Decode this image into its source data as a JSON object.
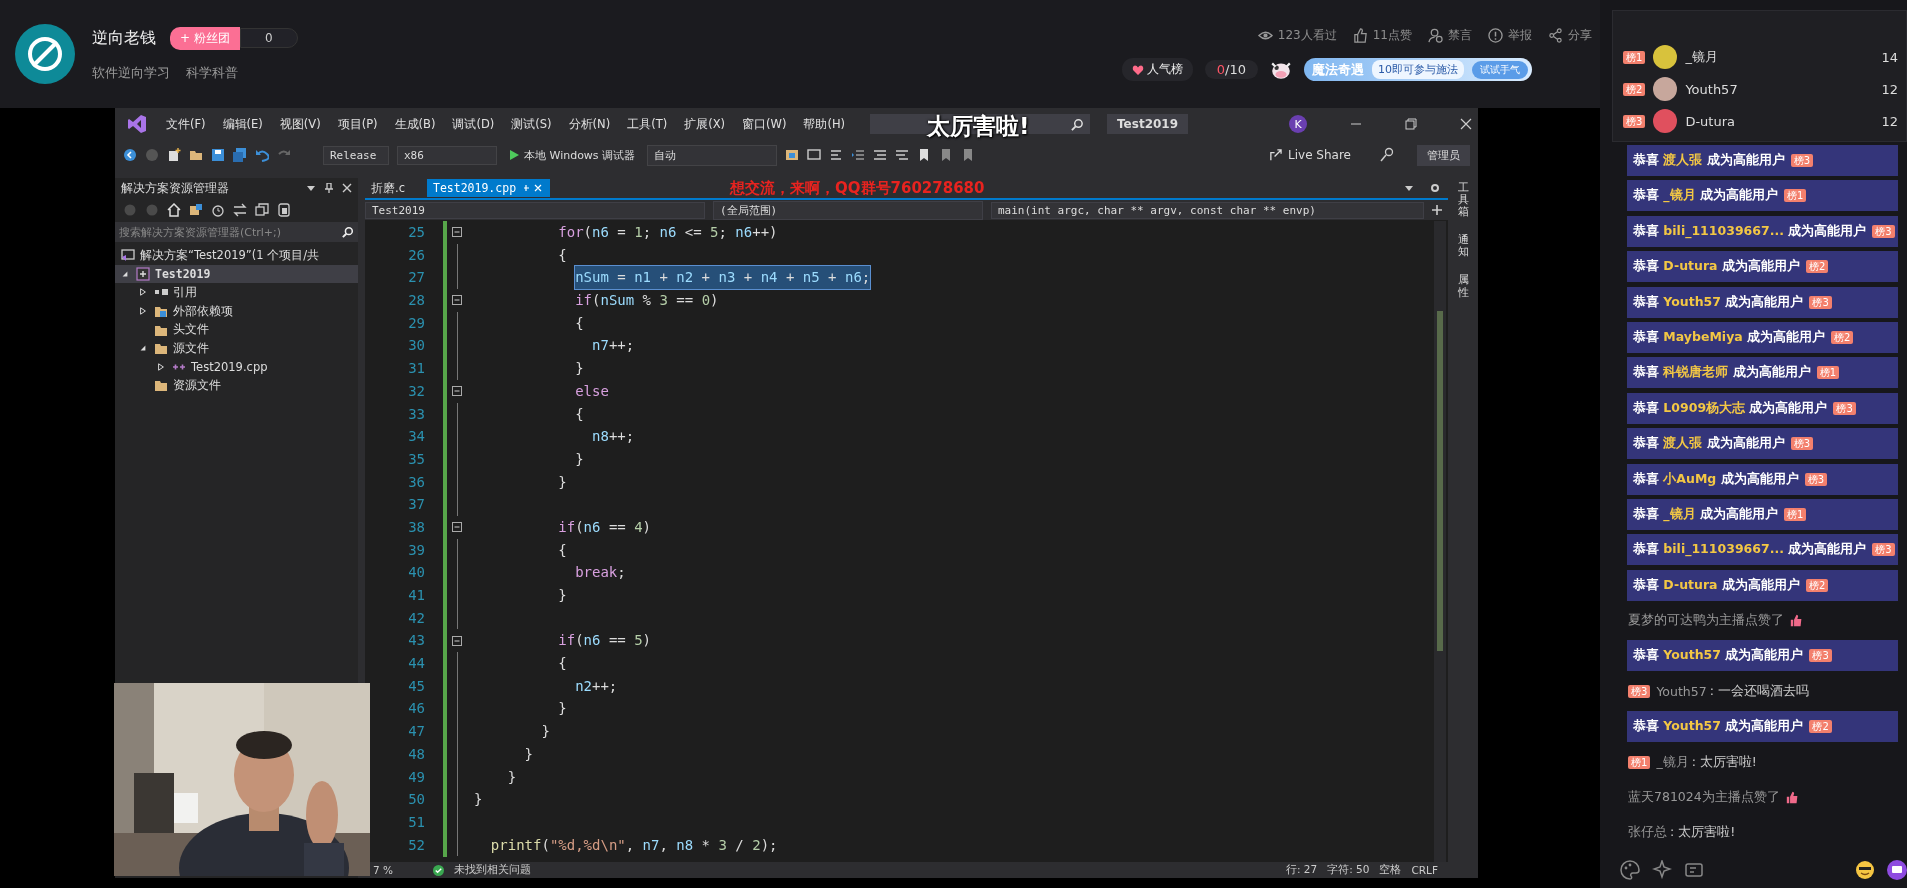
{
  "header": {
    "streamer": "逆向老钱",
    "fan_club": {
      "label": "+ 粉丝团",
      "count": "0"
    },
    "tags": [
      "软件逆向学习",
      "科学科普"
    ],
    "stats": [
      {
        "kind": "views",
        "label": "123人看过"
      },
      {
        "kind": "likes",
        "label": "11点赞"
      },
      {
        "kind": "mute",
        "label": "禁言"
      },
      {
        "kind": "report",
        "label": "举报"
      },
      {
        "kind": "share",
        "label": "分享"
      }
    ],
    "popularity": "人气榜",
    "progress_value": "0",
    "progress_total": "/10",
    "magic": {
      "title": "魔法奇遇",
      "text": "10即可参与施法",
      "button": "试试手气"
    }
  },
  "danmaku": "太厉害啦!",
  "overlay_text": "想交流，来啊，QQ群号760278680",
  "ide": {
    "menu": [
      "文件(F)",
      "编辑(E)",
      "视图(V)",
      "项目(P)",
      "生成(B)",
      "调试(D)",
      "测试(S)",
      "分析(N)",
      "工具(T)",
      "扩展(X)",
      "窗口(W)",
      "帮助(H)"
    ],
    "title": "Test2019",
    "account": "K",
    "toolbar": {
      "config": "Release",
      "platform": "x86",
      "debugger": "本地 Windows 调试器",
      "mode": "自动",
      "live_share": "Live Share",
      "admin": "管理员"
    },
    "explorer": {
      "title": "解决方案资源管理器",
      "search_placeholder": "搜索解决方案资源管理器(Ctrl+;)",
      "tree": [
        {
          "kind": "solution",
          "label": "解决方案“Test2019”(1 个项目/共",
          "selected": false,
          "children": [
            {
              "kind": "project",
              "label": "Test2019",
              "expanded": true,
              "selected": true,
              "children": [
                {
                  "kind": "references",
                  "label": "引用",
                  "expanded": false,
                  "selected": false
                },
                {
                  "kind": "external",
                  "label": "外部依赖项",
                  "expanded": false,
                  "selected": false
                },
                {
                  "kind": "filter",
                  "label": "头文件",
                  "selected": false
                },
                {
                  "kind": "filter",
                  "label": "源文件",
                  "expanded": true,
                  "selected": false,
                  "children": [
                    {
                      "kind": "cpp",
                      "label": "Test2019.cpp",
                      "expanded": false,
                      "selected": false
                    }
                  ]
                },
                {
                  "kind": "filter",
                  "label": "资源文件",
                  "selected": false
                }
              ]
            }
          ]
        }
      ]
    },
    "tabs": [
      {
        "label": "折磨.c",
        "selected": false
      },
      {
        "label": "Test2019.cpp",
        "selected": true
      }
    ],
    "nav": [
      "Test2019",
      "(全局范围)",
      "main(int argc, char ** argv, const char ** envp)"
    ],
    "code": [
      {
        "n": "25",
        "collapsible": true,
        "selected": false,
        "tokens": [
          {
            "text": "          for",
            "kind": "keyword"
          },
          {
            "text": "(",
            "kind": "punct"
          },
          {
            "text": "n6",
            "kind": "variable"
          },
          {
            "text": " = ",
            "kind": "punct"
          },
          {
            "text": "1",
            "kind": "number"
          },
          {
            "text": "; ",
            "kind": "punct"
          },
          {
            "text": "n6",
            "kind": "variable"
          },
          {
            "text": " <= ",
            "kind": "punct"
          },
          {
            "text": "5",
            "kind": "number"
          },
          {
            "text": "; ",
            "kind": "punct"
          },
          {
            "text": "n6",
            "kind": "variable"
          },
          {
            "text": "++)",
            "kind": "punct"
          }
        ]
      },
      {
        "n": "26",
        "collapsible": false,
        "selected": false,
        "tokens": [
          {
            "text": "          {",
            "kind": "punct"
          }
        ]
      },
      {
        "n": "27",
        "collapsible": false,
        "selected": true,
        "tokens": [
          {
            "text": "            nSum",
            "kind": "variable"
          },
          {
            "text": " = ",
            "kind": "punct"
          },
          {
            "text": "n1",
            "kind": "variable"
          },
          {
            "text": " + ",
            "kind": "punct"
          },
          {
            "text": "n2",
            "kind": "variable"
          },
          {
            "text": " + ",
            "kind": "punct"
          },
          {
            "text": "n3",
            "kind": "variable"
          },
          {
            "text": " + ",
            "kind": "punct"
          },
          {
            "text": "n4",
            "kind": "variable"
          },
          {
            "text": " + ",
            "kind": "punct"
          },
          {
            "text": "n5",
            "kind": "variable"
          },
          {
            "text": " + ",
            "kind": "punct"
          },
          {
            "text": "n6",
            "kind": "variable"
          },
          {
            "text": ";",
            "kind": "punct"
          }
        ]
      },
      {
        "n": "28",
        "collapsible": true,
        "selected": false,
        "tokens": [
          {
            "text": "            if",
            "kind": "keyword"
          },
          {
            "text": "(",
            "kind": "punct"
          },
          {
            "text": "nSum",
            "kind": "variable"
          },
          {
            "text": " % ",
            "kind": "punct"
          },
          {
            "text": "3",
            "kind": "number"
          },
          {
            "text": " == ",
            "kind": "punct"
          },
          {
            "text": "0",
            "kind": "number"
          },
          {
            "text": ")",
            "kind": "punct"
          }
        ]
      },
      {
        "n": "29",
        "collapsible": false,
        "selected": false,
        "tokens": [
          {
            "text": "            {",
            "kind": "punct"
          }
        ]
      },
      {
        "n": "30",
        "collapsible": false,
        "selected": false,
        "tokens": [
          {
            "text": "              n7",
            "kind": "variable"
          },
          {
            "text": "++;",
            "kind": "punct"
          }
        ]
      },
      {
        "n": "31",
        "collapsible": false,
        "selected": false,
        "tokens": [
          {
            "text": "            }",
            "kind": "punct"
          }
        ]
      },
      {
        "n": "32",
        "collapsible": true,
        "selected": false,
        "tokens": [
          {
            "text": "            else",
            "kind": "keyword"
          }
        ]
      },
      {
        "n": "33",
        "collapsible": false,
        "selected": false,
        "tokens": [
          {
            "text": "            {",
            "kind": "punct"
          }
        ]
      },
      {
        "n": "34",
        "collapsible": false,
        "selected": false,
        "tokens": [
          {
            "text": "              n8",
            "kind": "variable"
          },
          {
            "text": "++;",
            "kind": "punct"
          }
        ]
      },
      {
        "n": "35",
        "collapsible": false,
        "selected": false,
        "tokens": [
          {
            "text": "            }",
            "kind": "punct"
          }
        ]
      },
      {
        "n": "36",
        "collapsible": false,
        "selected": false,
        "tokens": [
          {
            "text": "          }",
            "kind": "punct"
          }
        ]
      },
      {
        "n": "37",
        "collapsible": false
      },
      {
        "n": "38",
        "collapsible": true,
        "selected": false,
        "tokens": [
          {
            "text": "          if",
            "kind": "keyword"
          },
          {
            "text": "(",
            "kind": "punct"
          },
          {
            "text": "n6",
            "kind": "variable"
          },
          {
            "text": " == ",
            "kind": "punct"
          },
          {
            "text": "4",
            "kind": "number"
          },
          {
            "text": ")",
            "kind": "punct"
          }
        ]
      },
      {
        "n": "39",
        "collapsible": false,
        "selected": false,
        "tokens": [
          {
            "text": "          {",
            "kind": "punct"
          }
        ]
      },
      {
        "n": "40",
        "collapsible": false,
        "selected": false,
        "tokens": [
          {
            "text": "            break",
            "kind": "keyword"
          },
          {
            "text": ";",
            "kind": "punct"
          }
        ]
      },
      {
        "n": "41",
        "collapsible": false,
        "selected": false,
        "tokens": [
          {
            "text": "          }",
            "kind": "punct"
          }
        ]
      },
      {
        "n": "42",
        "collapsible": false
      },
      {
        "n": "43",
        "collapsible": true,
        "selected": false,
        "tokens": [
          {
            "text": "          if",
            "kind": "keyword"
          },
          {
            "text": "(",
            "kind": "punct"
          },
          {
            "text": "n6",
            "kind": "variable"
          },
          {
            "text": " == ",
            "kind": "punct"
          },
          {
            "text": "5",
            "kind": "number"
          },
          {
            "text": ")",
            "kind": "punct"
          }
        ]
      },
      {
        "n": "44",
        "collapsible": false,
        "selected": false,
        "tokens": [
          {
            "text": "          {",
            "kind": "punct"
          }
        ]
      },
      {
        "n": "45",
        "collapsible": false,
        "selected": false,
        "tokens": [
          {
            "text": "            n2",
            "kind": "variable"
          },
          {
            "text": "++;",
            "kind": "punct"
          }
        ]
      },
      {
        "n": "46",
        "collapsible": false,
        "selected": false,
        "tokens": [
          {
            "text": "          }",
            "kind": "punct"
          }
        ]
      },
      {
        "n": "47",
        "collapsible": false,
        "selected": false,
        "tokens": [
          {
            "text": "        }",
            "kind": "punct"
          }
        ]
      },
      {
        "n": "48",
        "collapsible": false,
        "selected": false,
        "tokens": [
          {
            "text": "      }",
            "kind": "punct"
          }
        ]
      },
      {
        "n": "49",
        "collapsible": false,
        "selected": false,
        "tokens": [
          {
            "text": "    }",
            "kind": "punct"
          }
        ]
      },
      {
        "n": "50",
        "collapsible": false,
        "selected": false,
        "tokens": [
          {
            "text": "}",
            "kind": "punct"
          }
        ]
      },
      {
        "n": "51",
        "collapsible": false
      },
      {
        "n": "52",
        "collapsible": false,
        "selected": false,
        "tokens": [
          {
            "text": "  printf",
            "kind": "function"
          },
          {
            "text": "(",
            "kind": "punct"
          },
          {
            "text": "\"%d,%d\\n\"",
            "kind": "string"
          },
          {
            "text": ", ",
            "kind": "punct"
          },
          {
            "text": "n7",
            "kind": "variable"
          },
          {
            "text": ", ",
            "kind": "punct"
          },
          {
            "text": "n8",
            "kind": "variable"
          },
          {
            "text": " * ",
            "kind": "punct"
          },
          {
            "text": "3",
            "kind": "number"
          },
          {
            "text": " / ",
            "kind": "punct"
          },
          {
            "text": "2",
            "kind": "number"
          },
          {
            "text": ");",
            "kind": "punct"
          }
        ]
      }
    ],
    "status": {
      "zoom": "7 %",
      "issues": "未找到相关问题",
      "line": "行: 27",
      "char": "字符: 50",
      "indent": "空格",
      "eol": "CRLF"
    },
    "side_tabs": [
      "工具箱",
      "通知",
      "属性"
    ]
  },
  "chat": {
    "ranking": [
      {
        "badge": "榜1",
        "name": "_镜月",
        "score": "14",
        "color": "#d8c23c"
      },
      {
        "badge": "榜2",
        "name": "Youth57",
        "score": "12",
        "color": "#c7a79c"
      },
      {
        "badge": "榜3",
        "name": "D-utura",
        "score": "12",
        "color": "#e0505e"
      }
    ],
    "messages": [
      {
        "kind": "join",
        "prefix": "恭喜",
        "name": "渡人張",
        "suffix": "成为高能用户",
        "badge": "榜3"
      },
      {
        "kind": "join",
        "prefix": "恭喜",
        "name": "_镜月",
        "suffix": "成为高能用户",
        "badge": "榜1"
      },
      {
        "kind": "join",
        "prefix": "恭喜",
        "name": "bili_111039667...",
        "suffix": "成为高能用户",
        "badge": "榜3"
      },
      {
        "kind": "join",
        "prefix": "恭喜",
        "name": "D-utura",
        "suffix": "成为高能用户",
        "badge": "榜2"
      },
      {
        "kind": "join",
        "prefix": "恭喜",
        "name": "Youth57",
        "suffix": "成为高能用户",
        "badge": "榜3"
      },
      {
        "kind": "join",
        "prefix": "恭喜",
        "name": "MaybeMiya",
        "suffix": "成为高能用户",
        "badge": "榜2"
      },
      {
        "kind": "join",
        "prefix": "恭喜",
        "name": "科锐唐老师",
        "suffix": "成为高能用户",
        "badge": "榜1"
      },
      {
        "kind": "join",
        "prefix": "恭喜",
        "name": "L0909杨大志",
        "suffix": "成为高能用户",
        "badge": "榜3"
      },
      {
        "kind": "join",
        "prefix": "恭喜",
        "name": "渡人張",
        "suffix": "成为高能用户",
        "badge": "榜3"
      },
      {
        "kind": "join",
        "prefix": "恭喜",
        "name": "小AuMg",
        "suffix": "成为高能用户",
        "badge": "榜3"
      },
      {
        "kind": "join",
        "prefix": "恭喜",
        "name": "_镜月",
        "suffix": "成为高能用户",
        "badge": "榜1"
      },
      {
        "kind": "join",
        "prefix": "恭喜",
        "name": "bili_111039667...",
        "suffix": "成为高能用户",
        "badge": "榜3"
      },
      {
        "kind": "join",
        "prefix": "恭喜",
        "name": "D-utura",
        "suffix": "成为高能用户",
        "badge": "榜2"
      },
      {
        "kind": "like",
        "text": "夏梦的可达鸭为主播点赞了"
      },
      {
        "kind": "join",
        "prefix": "恭喜",
        "name": "Youth57",
        "suffix": "成为高能用户",
        "badge": "榜3"
      },
      {
        "kind": "chat",
        "badge": "榜3",
        "name": "Youth57",
        "text": ": 一会还喝酒去吗"
      },
      {
        "kind": "join",
        "prefix": "恭喜",
        "name": "Youth57",
        "suffix": "成为高能用户",
        "badge": "榜2"
      },
      {
        "kind": "chat",
        "badge": "榜1",
        "name": "_镜月",
        "text": ": 太厉害啦!"
      },
      {
        "kind": "like",
        "text": "蓝天781024为主播点赞了"
      },
      {
        "kind": "chat",
        "name": "张仔总",
        "text": ": 太厉害啦!"
      }
    ]
  }
}
